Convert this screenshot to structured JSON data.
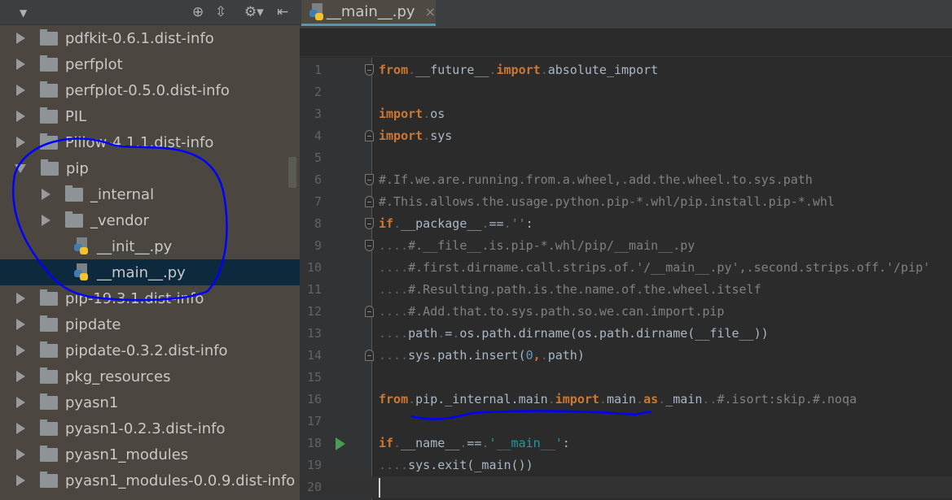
{
  "sidebar": {
    "toolbar_icons": [
      "collapse-dropdown-icon",
      "locate-icon",
      "collapse-all-icon",
      "gear-icon",
      "hide-panel-icon"
    ],
    "items": [
      {
        "label": "pdfkit-0.6.1.dist-info",
        "type": "folder",
        "depth": 0,
        "expanded": false
      },
      {
        "label": "perfplot",
        "type": "folder",
        "depth": 0,
        "expanded": false
      },
      {
        "label": "perfplot-0.5.0.dist-info",
        "type": "folder",
        "depth": 0,
        "expanded": false
      },
      {
        "label": "PIL",
        "type": "folder",
        "depth": 0,
        "expanded": false
      },
      {
        "label": "Pillow-4.1.1.dist-info",
        "type": "folder",
        "depth": 0,
        "expanded": false
      },
      {
        "label": "pip",
        "type": "folder",
        "depth": 0,
        "expanded": true
      },
      {
        "label": "_internal",
        "type": "folder",
        "depth": 1,
        "expanded": false
      },
      {
        "label": "_vendor",
        "type": "folder",
        "depth": 1,
        "expanded": false
      },
      {
        "label": "__init__.py",
        "type": "python",
        "depth": 1
      },
      {
        "label": "__main__.py",
        "type": "python",
        "depth": 1,
        "selected": true
      },
      {
        "label": "pip-19.3.1.dist-info",
        "type": "folder",
        "depth": 0,
        "expanded": false
      },
      {
        "label": "pipdate",
        "type": "folder",
        "depth": 0,
        "expanded": false
      },
      {
        "label": "pipdate-0.3.2.dist-info",
        "type": "folder",
        "depth": 0,
        "expanded": false
      },
      {
        "label": "pkg_resources",
        "type": "folder",
        "depth": 0,
        "expanded": false
      },
      {
        "label": "pyasn1",
        "type": "folder",
        "depth": 0,
        "expanded": false
      },
      {
        "label": "pyasn1-0.2.3.dist-info",
        "type": "folder",
        "depth": 0,
        "expanded": false
      },
      {
        "label": "pyasn1_modules",
        "type": "folder",
        "depth": 0,
        "expanded": false
      },
      {
        "label": "pyasn1_modules-0.0.9.dist-info",
        "type": "folder",
        "depth": 0,
        "expanded": false
      }
    ]
  },
  "editor": {
    "tab": {
      "label": "__main__.py",
      "close": "×"
    },
    "colors": {
      "keyword": "#cc7832",
      "text": "#a9b7c6",
      "comment": "#808080",
      "string": "#20999d",
      "number": "#6897bb",
      "annotation": "#0000ff"
    },
    "lines": [
      {
        "n": "1",
        "fold": "down",
        "t": [
          [
            "from",
            "kw"
          ],
          [
            ".",
            "ws"
          ],
          [
            "__future__",
            ""
          ],
          [
            ".",
            "ws"
          ],
          [
            "import",
            "kw"
          ],
          [
            ".",
            "ws"
          ],
          [
            "absolute_import",
            ""
          ]
        ]
      },
      {
        "n": "2",
        "t": []
      },
      {
        "n": "3",
        "t": [
          [
            "import",
            "kw"
          ],
          [
            ".",
            "ws"
          ],
          [
            "os",
            ""
          ]
        ]
      },
      {
        "n": "4",
        "fold": "up",
        "t": [
          [
            "import",
            "kw"
          ],
          [
            ".",
            "ws"
          ],
          [
            "sys",
            ""
          ]
        ]
      },
      {
        "n": "5",
        "t": []
      },
      {
        "n": "6",
        "fold": "down",
        "t": [
          [
            "#.If.we.are.running.from.a.wheel,.add.the.wheel.to.sys.path",
            "cm"
          ]
        ]
      },
      {
        "n": "7",
        "fold": "up",
        "t": [
          [
            "#.This.allows.the.usage.python.pip-*.whl/pip.install.pip-*.whl",
            "cm"
          ]
        ]
      },
      {
        "n": "8",
        "fold": "down",
        "t": [
          [
            "if",
            "kw"
          ],
          [
            ".",
            "ws"
          ],
          [
            "__package__",
            ""
          ],
          [
            ".",
            "ws"
          ],
          [
            "==",
            ""
          ],
          [
            ".",
            "ws"
          ],
          [
            "''",
            "st2"
          ],
          [
            ":",
            ""
          ]
        ]
      },
      {
        "n": "9",
        "fold": "down",
        "t": [
          [
            "....",
            "ws"
          ],
          [
            "#.__file__.is.pip-*.whl/pip/__main__.py",
            "cm"
          ]
        ]
      },
      {
        "n": "10",
        "t": [
          [
            "....",
            "ws"
          ],
          [
            "#.first.dirname.call.strips.of.'/__main__.py',.second.strips.off.'/pip'",
            "cm"
          ]
        ]
      },
      {
        "n": "11",
        "t": [
          [
            "....",
            "ws"
          ],
          [
            "#.Resulting.path.is.the.name.of.the.wheel.itself",
            "cm"
          ]
        ]
      },
      {
        "n": "12",
        "fold": "up",
        "t": [
          [
            "....",
            "ws"
          ],
          [
            "#.Add.that.to.sys.path.so.we.can.import.pip",
            "cm"
          ]
        ]
      },
      {
        "n": "13",
        "t": [
          [
            "....",
            "ws"
          ],
          [
            "path",
            ""
          ],
          [
            ".",
            "ws"
          ],
          [
            "=",
            ""
          ],
          [
            ".",
            "ws"
          ],
          [
            "os.path.dirname(os.path.dirname(__file__))",
            ""
          ]
        ]
      },
      {
        "n": "14",
        "fold": "up",
        "t": [
          [
            "....",
            "ws"
          ],
          [
            "sys.path.insert(",
            ""
          ],
          [
            "0",
            "nm"
          ],
          [
            ",",
            "kw"
          ],
          [
            ".",
            "ws"
          ],
          [
            "path)",
            ""
          ]
        ]
      },
      {
        "n": "15",
        "t": []
      },
      {
        "n": "16",
        "t": [
          [
            "from",
            "kw"
          ],
          [
            ".",
            "ws"
          ],
          [
            "pip._internal.main",
            ""
          ],
          [
            ".",
            "ws"
          ],
          [
            "import",
            "kw"
          ],
          [
            ".",
            "ws"
          ],
          [
            "main",
            ""
          ],
          [
            ".",
            "ws"
          ],
          [
            "as",
            "kw"
          ],
          [
            ".",
            "ws"
          ],
          [
            "_main",
            ""
          ],
          [
            "..",
            "ws"
          ],
          [
            "#.isort:skip.#.noqa",
            "cm"
          ]
        ]
      },
      {
        "n": "17",
        "t": []
      },
      {
        "n": "18",
        "run": true,
        "t": [
          [
            "if",
            "kw"
          ],
          [
            ".",
            "ws"
          ],
          [
            "__name__",
            ""
          ],
          [
            ".",
            "ws"
          ],
          [
            "==",
            ""
          ],
          [
            ".",
            "ws"
          ],
          [
            "'__main__'",
            "st"
          ],
          [
            ":",
            ""
          ]
        ]
      },
      {
        "n": "19",
        "t": [
          [
            "....",
            "ws"
          ],
          [
            "sys.exit(_main())",
            ""
          ]
        ]
      },
      {
        "n": "20",
        "current": true,
        "t": []
      }
    ]
  }
}
